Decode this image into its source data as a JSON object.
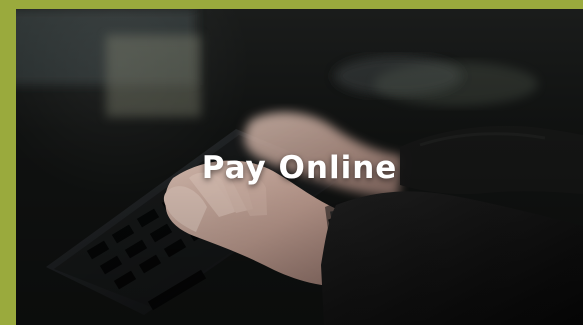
{
  "hero": {
    "title": "Pay Online",
    "accent_color": "#9aaa3d",
    "background_description_icon": "keyboard-hands-photo"
  }
}
